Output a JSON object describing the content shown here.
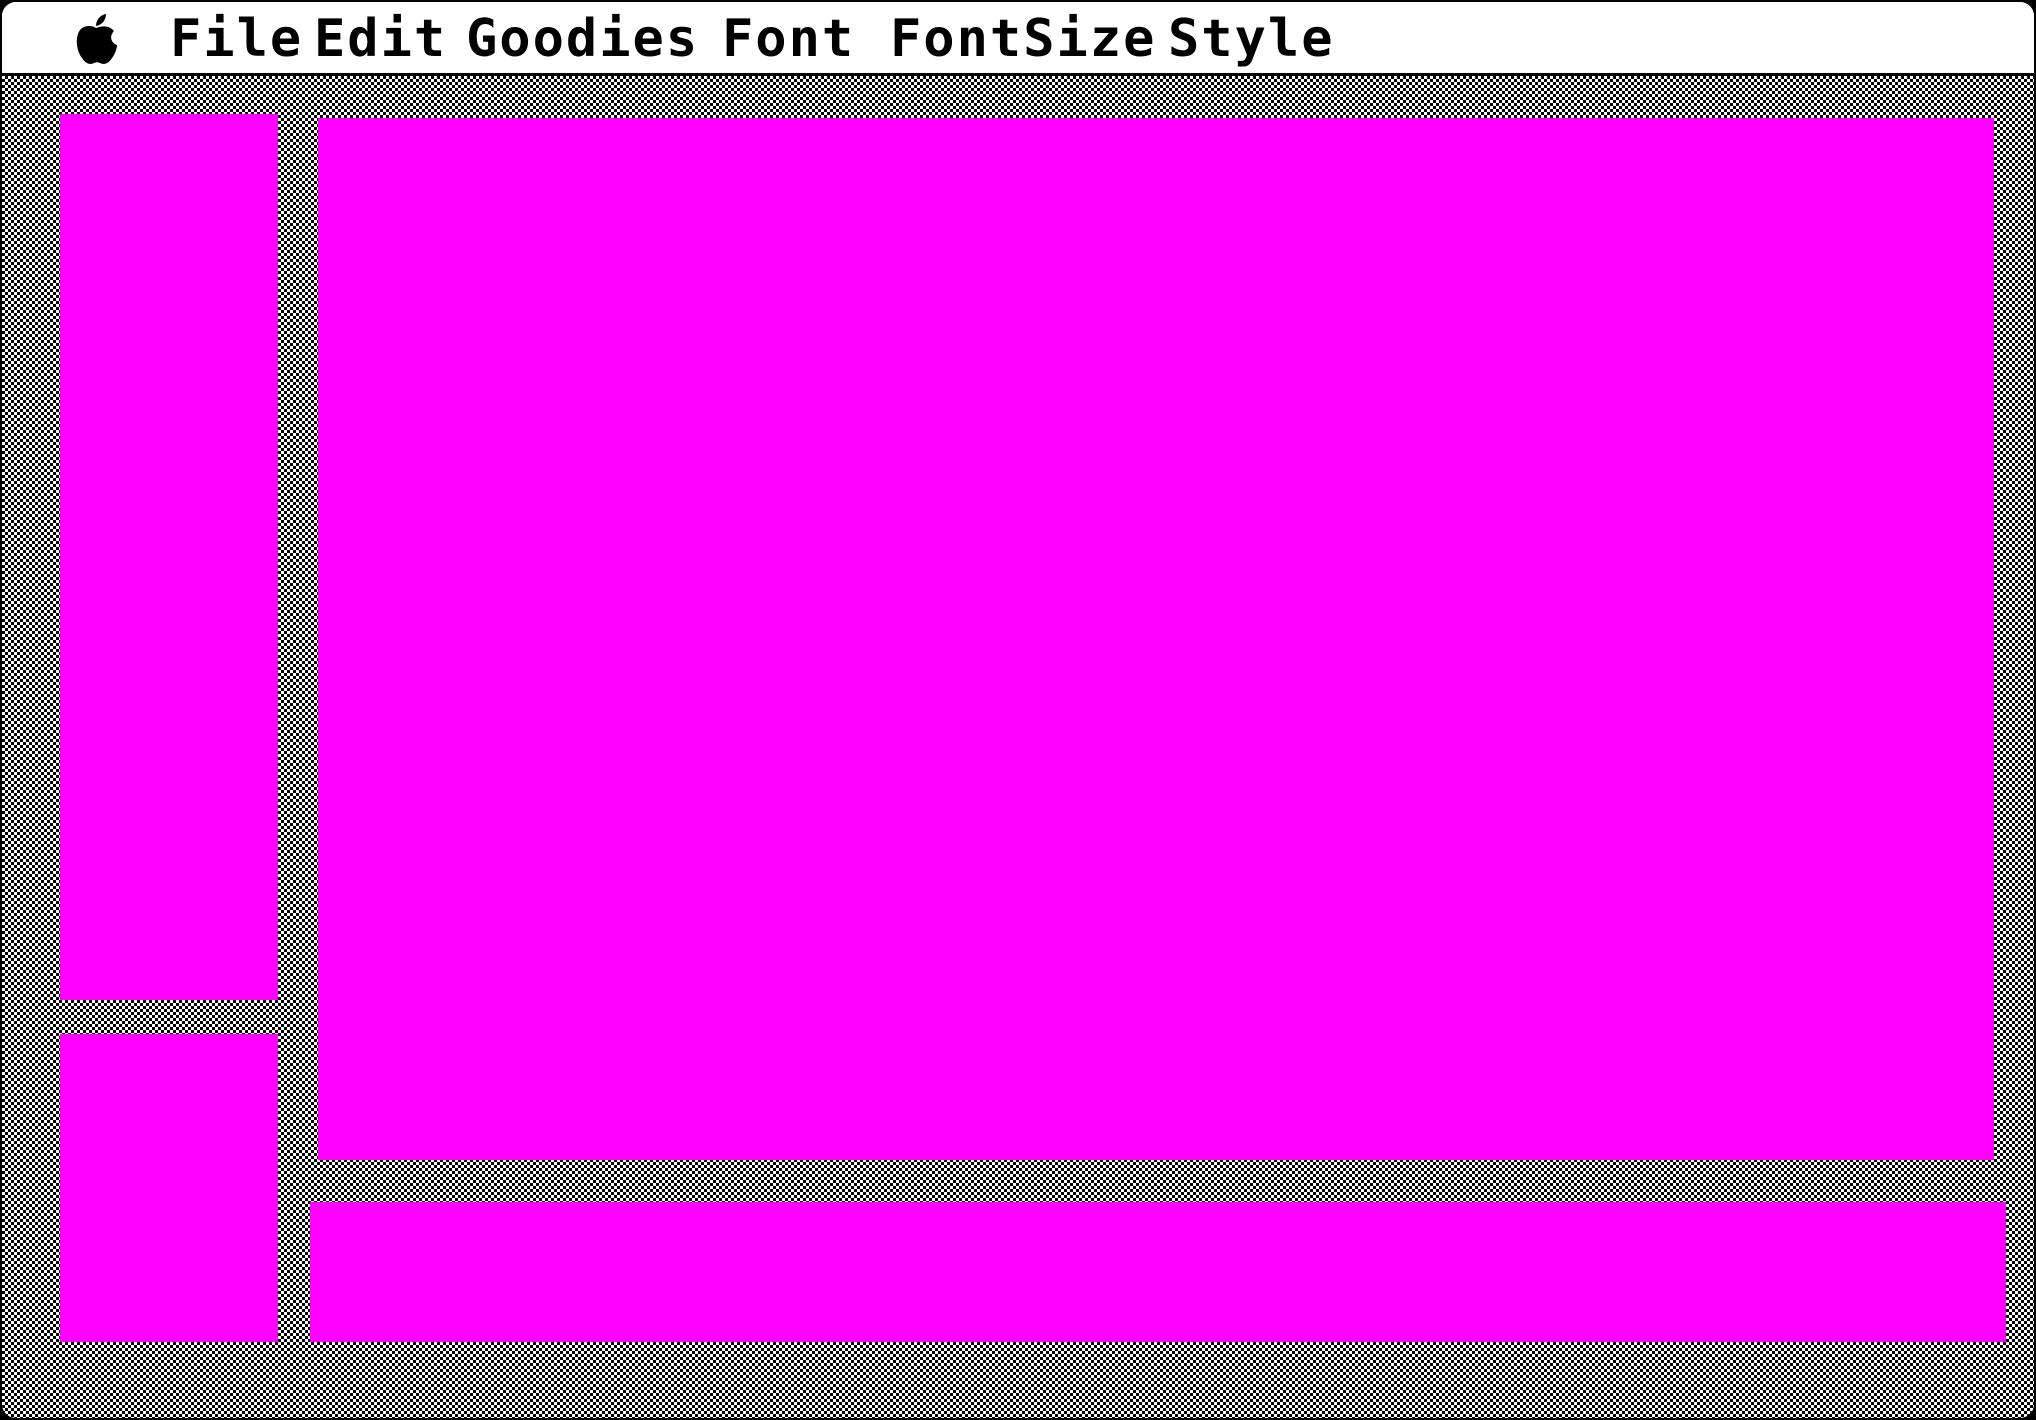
{
  "menubar": {
    "apple_icon": "apple-logo-icon",
    "items": [
      {
        "label": "File"
      },
      {
        "label": "Edit"
      },
      {
        "label": "Goodies"
      },
      {
        "label": "Font"
      },
      {
        "label": "FontSize"
      },
      {
        "label": "Style"
      }
    ]
  },
  "desktop": {
    "pattern": "checkerboard-dither",
    "pattern_colors": [
      "#000000",
      "#ffffff"
    ]
  },
  "panels": {
    "color": "#ff00ff",
    "items": [
      "tools-palette",
      "tool-options-box",
      "main-canvas",
      "bottom-strip"
    ]
  }
}
